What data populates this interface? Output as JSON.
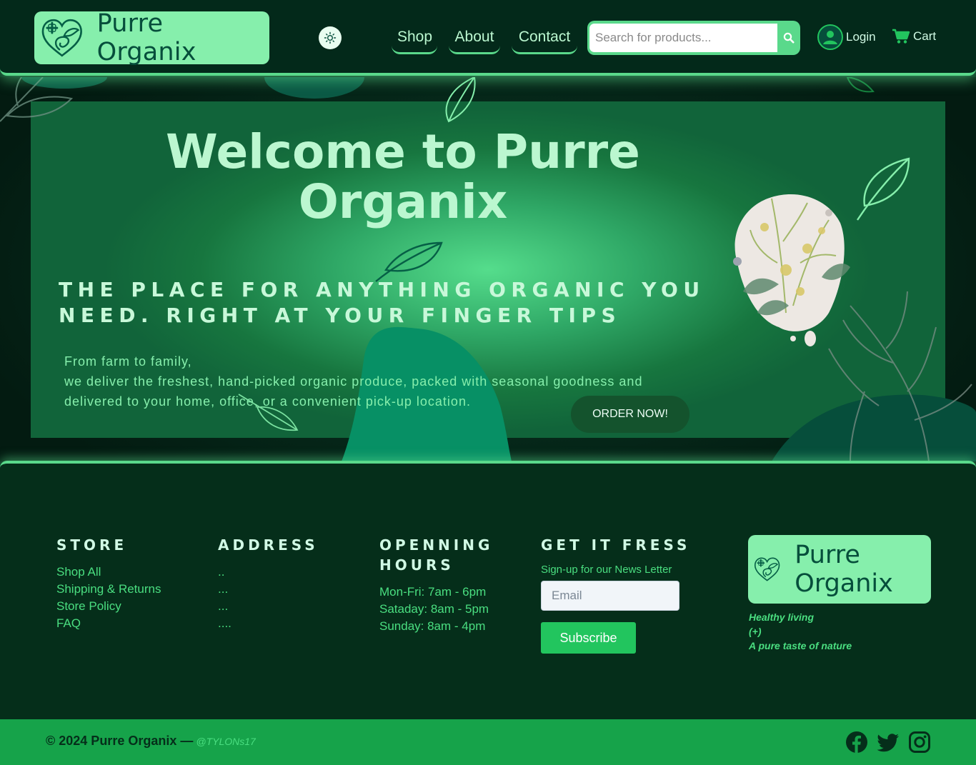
{
  "header": {
    "brand": "Purre Organix",
    "nav": {
      "shop": "Shop",
      "about": "About",
      "contact": "Contact"
    },
    "search_placeholder": "Search for products...",
    "login_label": "Login",
    "cart_label": "Cart"
  },
  "hero": {
    "title": "Welcome to Purre Organix",
    "tagline": "THE PLACE FOR ANYTHING ORGANIC YOU NEED. RIGHT AT YOUR FINGER TIPS",
    "desc_line1": "From farm to family,",
    "desc_line2": "we deliver the freshest, hand-picked organic produce, packed with seasonal goodness and delivered to your home, office, or a convenient pick-up location.",
    "order_button": "ORDER NOW!"
  },
  "footer": {
    "store": {
      "title": "STORE",
      "links": [
        "Shop All",
        "Shipping & Returns",
        "Store Policy",
        "FAQ"
      ]
    },
    "address": {
      "title": "ADDRESS",
      "lines": [
        "..",
        "...",
        "...",
        "...."
      ]
    },
    "hours": {
      "title": "OPENNING HOURS",
      "lines": [
        "Mon-Fri: 7am - 6pm",
        "Sataday: 8am - 5pm",
        "Sunday: 8am - 4pm"
      ]
    },
    "newsletter": {
      "title": "GET IT FRESS",
      "label": "Sign-up for our News Letter",
      "email_placeholder": "Email",
      "subscribe": "Subscribe"
    },
    "brand": "Purre Organix",
    "tagline_lines": [
      "Healthy living",
      "(+)",
      "A pure taste of nature"
    ]
  },
  "bottom": {
    "copyright": "© 2024 Purre Organix —",
    "handle": "@TYLONs17"
  },
  "icons": {
    "logo": "heart-leaf-cross-icon",
    "theme": "sun-icon",
    "search": "search-icon",
    "user": "user-circle-icon",
    "cart": "cart-icon",
    "social": [
      "facebook-icon",
      "twitter-icon",
      "instagram-icon"
    ]
  },
  "colors": {
    "accent": "#5ad98b",
    "brand_light": "#86efac",
    "dark_bg": "#052e1a",
    "bottom_bar": "#16a34a"
  }
}
